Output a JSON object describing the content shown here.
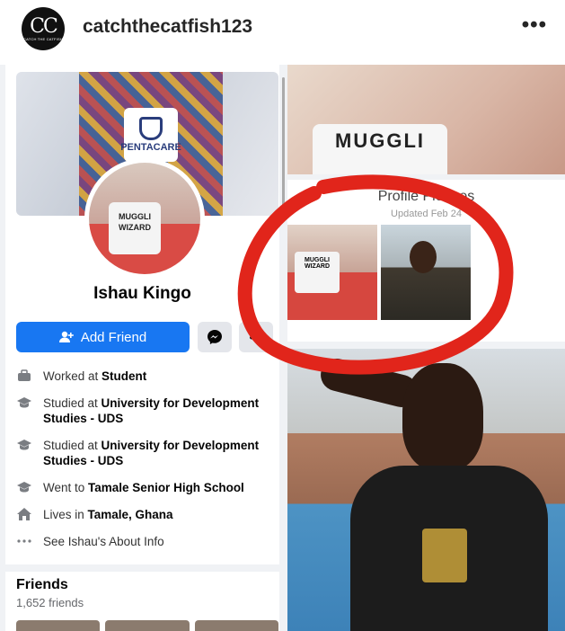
{
  "instagram": {
    "avatar_initials": "CC",
    "avatar_subtext": "CATCH THE CATFISH",
    "username": "catchthecatfish123",
    "more": "•••"
  },
  "profile": {
    "name": "Ishau Kingo",
    "cover_logo_text": "PENTACARE",
    "mug_text": "MUGGLI WIZARD"
  },
  "actions": {
    "add_friend": "Add Friend",
    "more": "•••"
  },
  "about": [
    {
      "icon": "briefcase-icon",
      "prefix": "Worked at ",
      "bold": "Student"
    },
    {
      "icon": "graduation-cap-icon",
      "prefix": "Studied at ",
      "bold": "University for Development Studies - UDS"
    },
    {
      "icon": "graduation-cap-icon",
      "prefix": "Studied at ",
      "bold": "University for Development Studies - UDS"
    },
    {
      "icon": "graduation-cap-icon",
      "prefix": "Went to ",
      "bold": "Tamale Senior High School"
    },
    {
      "icon": "home-icon",
      "prefix": "Lives in ",
      "bold": "Tamale, Ghana"
    },
    {
      "icon": "ellipsis-icon",
      "prefix": "See Ishau's About Info",
      "bold": ""
    }
  ],
  "friends": {
    "title": "Friends",
    "count": "1,652 friends"
  },
  "profile_pictures": {
    "title": "Profile Pictures",
    "updated": "Updated Feb 24"
  },
  "photo_mug_text": "MUGGLI"
}
